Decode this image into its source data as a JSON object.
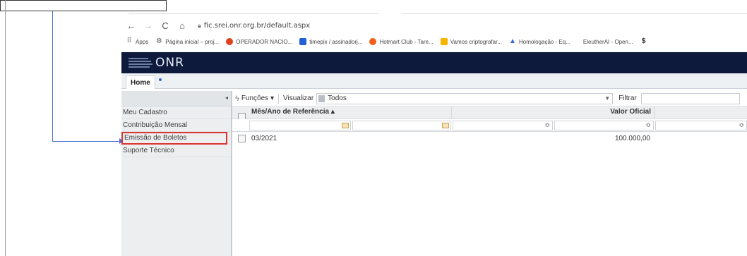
{
  "browser": {
    "url": "fic.srei.onr.org.br/default.aspx",
    "nav_icons": [
      "back-arrow-icon",
      "forward-arrow-icon",
      "reload-icon",
      "home-icon"
    ],
    "bookmarks": [
      {
        "label": "Apps",
        "icon": "apps-grid-icon"
      },
      {
        "label": "Página inicial – proj...",
        "icon": "gear-icon"
      },
      {
        "label": "OPERADOR NACIO...",
        "icon": "onr-circle-icon"
      },
      {
        "label": "timepix / assinadorj...",
        "icon": "bookmark-blue-icon"
      },
      {
        "label": "Hotmart Club - Tare...",
        "icon": "hotmart-icon"
      },
      {
        "label": "Vamos criptografar...",
        "icon": "bitcoin-icon"
      },
      {
        "label": "Homologação - Eq...",
        "icon": "triangle-icon"
      },
      {
        "label": "EleutherAI - Open...",
        "icon": "blank-icon"
      },
      {
        "label": "",
        "icon": "dollar-icon"
      }
    ]
  },
  "app": {
    "logo_text": "ONR",
    "brand_color": "#0d1a3c",
    "tab_label": "Home"
  },
  "sidebar": {
    "items": [
      {
        "label": "Meu Cadastro"
      },
      {
        "label": "Contribuição Mensal"
      },
      {
        "label": "Emissão de Boletos",
        "highlighted": true
      },
      {
        "label": "Suporte Técnico"
      }
    ]
  },
  "toolbar": {
    "functions_label": "Funções ▾",
    "view_label": "Visualizar",
    "view_value": "Todos",
    "filter_label": "Filtrar"
  },
  "grid": {
    "headers": {
      "ref": "Mês/Ano de Referência ▴",
      "valor": "Valor Oficial"
    },
    "rows": [
      {
        "ref": "03/2021",
        "valor": "100.000,00"
      }
    ]
  },
  "annotation": {
    "highlight_color": "#dd3333",
    "arrow_color": "#4a6fd1"
  }
}
